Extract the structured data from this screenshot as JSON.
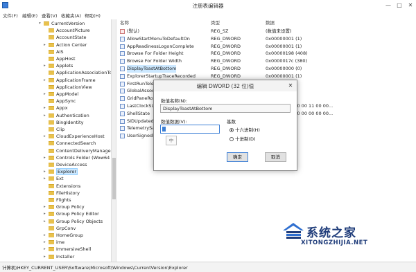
{
  "window": {
    "title": "注册表编辑器",
    "controls": {
      "minimize": "—",
      "maximize": "□",
      "close": "✕"
    }
  },
  "menu": [
    "文件(F)",
    "编辑(E)",
    "查看(V)",
    "收藏夹(A)",
    "帮助(H)"
  ],
  "tree": {
    "items": [
      {
        "label": "CurrentVersion",
        "arrow": "▾",
        "level": 0
      },
      {
        "label": "AccountPicture",
        "arrow": "",
        "level": 1
      },
      {
        "label": "AccountState",
        "arrow": "",
        "level": 1
      },
      {
        "label": "Action Center",
        "arrow": "▸",
        "level": 1
      },
      {
        "label": "AIS",
        "arrow": "",
        "level": 1
      },
      {
        "label": "AppHost",
        "arrow": "",
        "level": 1
      },
      {
        "label": "Applets",
        "arrow": "▸",
        "level": 1
      },
      {
        "label": "ApplicationAssociationTo",
        "arrow": "",
        "level": 1
      },
      {
        "label": "ApplicationFrame",
        "arrow": "▸",
        "level": 1
      },
      {
        "label": "ApplicationView",
        "arrow": "",
        "level": 1
      },
      {
        "label": "AppModel",
        "arrow": "▸",
        "level": 1
      },
      {
        "label": "AppSync",
        "arrow": "",
        "level": 1
      },
      {
        "label": "Appx",
        "arrow": "▸",
        "level": 1
      },
      {
        "label": "Authentication",
        "arrow": "▸",
        "level": 1
      },
      {
        "label": "BingIdentity",
        "arrow": "",
        "level": 1
      },
      {
        "label": "Clip",
        "arrow": "",
        "level": 1
      },
      {
        "label": "CloudExperienceHost",
        "arrow": "▸",
        "level": 1
      },
      {
        "label": "ConnectedSearch",
        "arrow": "",
        "level": 1
      },
      {
        "label": "ContentDeliveryManager",
        "arrow": "",
        "level": 1
      },
      {
        "label": "Controls Folder (Wow64",
        "arrow": "▸",
        "level": 1
      },
      {
        "label": "DeviceAccess",
        "arrow": "",
        "level": 1
      },
      {
        "label": "Explorer",
        "arrow": "▸",
        "level": 1
      },
      {
        "label": "Ext",
        "arrow": "▸",
        "level": 1
      },
      {
        "label": "Extensions",
        "arrow": "",
        "level": 1
      },
      {
        "label": "FileHistory",
        "arrow": "",
        "level": 1
      },
      {
        "label": "Flights",
        "arrow": "",
        "level": 1
      },
      {
        "label": "Group Policy",
        "arrow": "▸",
        "level": 1
      },
      {
        "label": "Group Policy Editor",
        "arrow": "▸",
        "level": 1
      },
      {
        "label": "Group Policy Objects",
        "arrow": "▸",
        "level": 1
      },
      {
        "label": "GrpConv",
        "arrow": "",
        "level": 1
      },
      {
        "label": "HomeGroup",
        "arrow": "▸",
        "level": 1
      },
      {
        "label": "ime",
        "arrow": "▸",
        "level": 1
      },
      {
        "label": "ImmersiveShell",
        "arrow": "▸",
        "level": 1
      },
      {
        "label": "Installer",
        "arrow": "▸",
        "level": 1
      }
    ],
    "selected_index": 21
  },
  "list": {
    "headers": {
      "name": "名称",
      "type": "类型",
      "data": "数据"
    },
    "rows": [
      {
        "name": "(默认)",
        "type": "REG_SZ",
        "data": "(数值未设置)",
        "icon": "string"
      },
      {
        "name": "AllowStartMenuToDefaultOn",
        "type": "REG_DWORD",
        "data": "0x00000001 (1)",
        "icon": "dword"
      },
      {
        "name": "AppReadinessLogonComplete",
        "type": "REG_DWORD",
        "data": "0x00000001 (1)",
        "icon": "dword"
      },
      {
        "name": "Browse For Folder Height",
        "type": "REG_DWORD",
        "data": "0x00000198 (408)",
        "icon": "dword"
      },
      {
        "name": "Browse For Folder Width",
        "type": "REG_DWORD",
        "data": "0x0000017c (380)",
        "icon": "dword"
      },
      {
        "name": "DisplayToastAtBottom",
        "type": "REG_DWORD",
        "data": "0x00000000 (0)",
        "icon": "dword"
      },
      {
        "name": "ExplorerStartupTraceRecorded",
        "type": "REG_DWORD",
        "data": "0x00000001 (1)",
        "icon": "dword"
      },
      {
        "name": "FirstRunTeleme",
        "type": "",
        "data": "",
        "icon": "dword"
      },
      {
        "name": "GlobalAssocCh",
        "type": "",
        "data": "",
        "icon": "dword"
      },
      {
        "name": "GridPaneRowC",
        "type": "",
        "data": "",
        "icon": "dword"
      },
      {
        "name": "LastClockSize",
        "type": "",
        "data": "00 00 42 00 00 00 11 00 00...",
        "icon": "dword"
      },
      {
        "name": "ShellState",
        "type": "",
        "data": "00 00 00 00 00 00 00 00 00...",
        "icon": "dword"
      },
      {
        "name": "SIDUpdatedOn",
        "type": "",
        "data": "",
        "icon": "dword"
      },
      {
        "name": "TelemetrySalt",
        "type": "",
        "data": "",
        "icon": "dword"
      },
      {
        "name": "UserSignedIn",
        "type": "",
        "data": "",
        "icon": "dword"
      }
    ]
  },
  "status": "计算机\\HKEY_CURRENT_USER\\Software\\Microsoft\\Windows\\CurrentVersion\\Explorer",
  "dialog": {
    "title": "编辑 DWORD (32 位)值",
    "close": "✕",
    "name_label": "数值名称(N):",
    "name_value": "DisplayToastAtBottom",
    "data_label": "数值数据(V):",
    "base_label": "基数",
    "radio_hex": "十六进制(H)",
    "radio_dec": "十进制(D)",
    "selected_base": "hex",
    "ime_indicator": "中",
    "ok": "确定",
    "cancel": "取消"
  },
  "watermark": {
    "text": "系统之家",
    "url": "XITONGZHIJIA.NET"
  }
}
